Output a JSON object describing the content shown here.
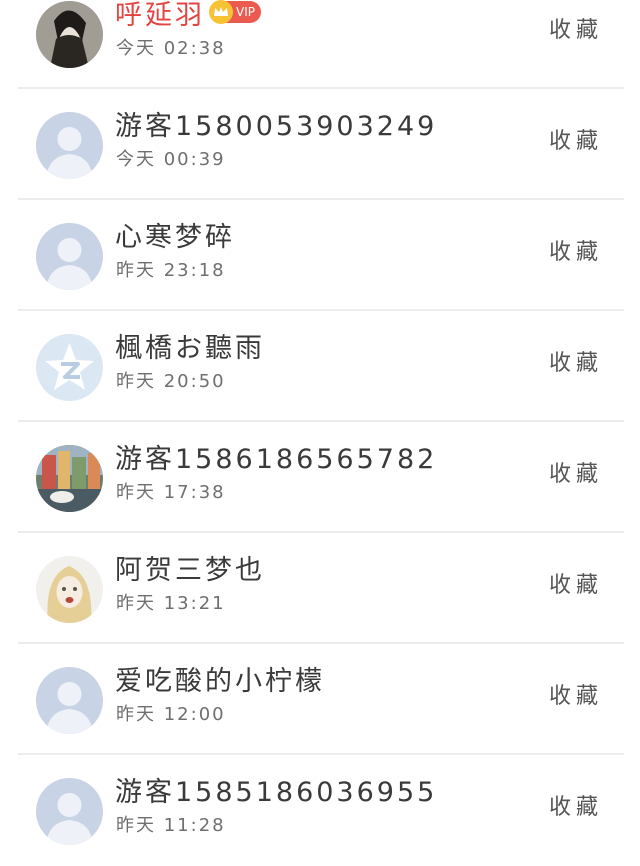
{
  "action_label": "收藏",
  "vip_label": "VIP",
  "colors": {
    "vip_name": "#e4443f",
    "vip_badge": "#ea5a4e",
    "crown": "#f7c233",
    "divider": "#ececec"
  },
  "users": [
    {
      "name": "呼延羽",
      "time": "今天 02:38",
      "vip": true,
      "avatar": "photo-dark-figure"
    },
    {
      "name": "游客15800539032​49",
      "time": "今天 00:39",
      "vip": false,
      "avatar": "default-silhouette"
    },
    {
      "name": "心寒梦碎",
      "time": "昨天 23:18",
      "vip": false,
      "avatar": "default-silhouette"
    },
    {
      "name": "楓橋お聽雨",
      "time": "昨天 20:50",
      "vip": false,
      "avatar": "qzone-star"
    },
    {
      "name": "游客1586186565782",
      "time": "昨天 17:38",
      "vip": false,
      "avatar": "photo-street-bird"
    },
    {
      "name": "阿贺三梦也",
      "time": "昨天 13:21",
      "vip": false,
      "avatar": "photo-blonde-girl"
    },
    {
      "name": "爱吃酸的小柠檬",
      "time": "昨天 12:00",
      "vip": false,
      "avatar": "default-silhouette"
    },
    {
      "name": "游客1585186036955",
      "time": "昨天 11:28",
      "vip": false,
      "avatar": "default-silhouette"
    }
  ]
}
